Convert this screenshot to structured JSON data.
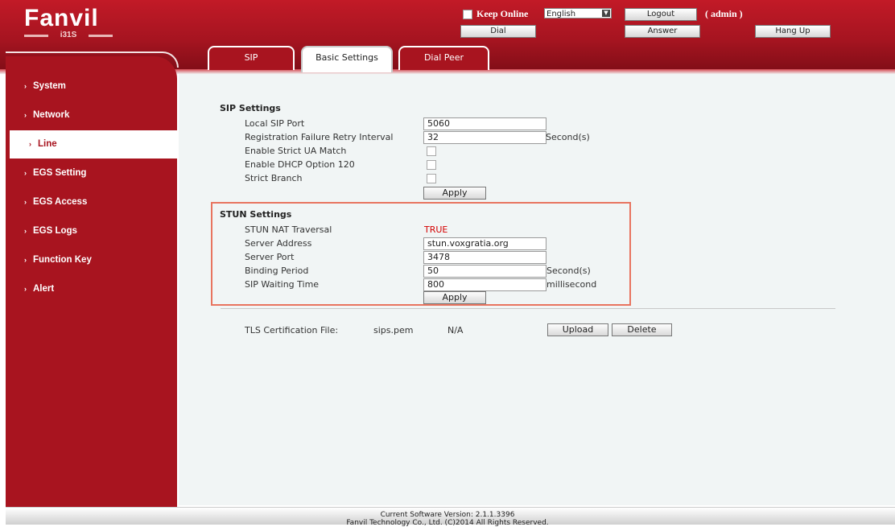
{
  "brand": {
    "logo_text": "Fanvil",
    "model": "i31S"
  },
  "header": {
    "keep_online_label": "Keep Online",
    "language_selected": "English",
    "logout_label": "Logout",
    "user_label": "( admin )",
    "dial_label": "Dial",
    "answer_label": "Answer",
    "hangup_label": "Hang Up"
  },
  "sidebar": {
    "items": [
      {
        "label": "System"
      },
      {
        "label": "Network"
      },
      {
        "label": "Line"
      },
      {
        "label": "EGS Setting"
      },
      {
        "label": "EGS Access"
      },
      {
        "label": "EGS Logs"
      },
      {
        "label": "Function Key"
      },
      {
        "label": "Alert"
      }
    ],
    "active": "Line"
  },
  "tabs": [
    {
      "label": "SIP"
    },
    {
      "label": "Basic Settings"
    },
    {
      "label": "Dial Peer"
    }
  ],
  "sip_settings": {
    "title": "SIP Settings",
    "local_sip_port_label": "Local SIP Port",
    "local_sip_port_value": "5060",
    "retry_interval_label": "Registration Failure Retry Interval",
    "retry_interval_value": "32",
    "retry_interval_unit": "Second(s)",
    "strict_ua_label": "Enable Strict UA Match",
    "dhcp_option_label": "Enable DHCP Option 120",
    "strict_branch_label": "Strict Branch",
    "apply_label": "Apply"
  },
  "stun_settings": {
    "title": "STUN Settings",
    "nat_traversal_label": "STUN NAT Traversal",
    "nat_traversal_value": "TRUE",
    "server_address_label": "Server Address",
    "server_address_value": "stun.voxgratia.org",
    "server_port_label": "Server Port",
    "server_port_value": "3478",
    "binding_period_label": "Binding Period",
    "binding_period_value": "50",
    "binding_period_unit": "Second(s)",
    "sip_waiting_label": "SIP Waiting Time",
    "sip_waiting_value": "800",
    "sip_waiting_unit": "millisecond",
    "apply_label": "Apply"
  },
  "tls": {
    "label": "TLS Certification File:",
    "file_name": "sips.pem",
    "status": "N/A",
    "upload_label": "Upload",
    "delete_label": "Delete"
  },
  "footer": {
    "version": "Current Software Version: 2.1.1.3396",
    "copyright": "Fanvil Technology Co., Ltd. (C)2014 All Rights Reserved."
  },
  "colors": {
    "brand_red": "#a8141f",
    "stun_border": "#e8745f",
    "true_value": "#d40000"
  }
}
